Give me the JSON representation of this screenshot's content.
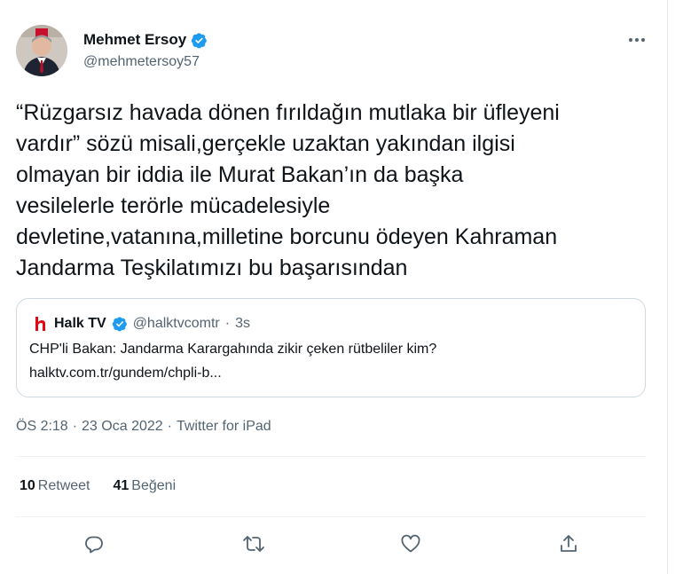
{
  "author": {
    "name": "Mehmet Ersoy",
    "handle": "@mehmetersoy57"
  },
  "tweet": {
    "text": "“Rüzgarsız havada dönen fırıldağın mutlaka bir üfleyeni\nvardır” sözü misali,gerçekle uzaktan yakından ilgisi\nolmayan bir iddia ile Murat Bakan’ın da başka\nvesilelerle terörle mücadelesiyle\ndevletine,vatanına,milletine borcunu ödeyen Kahraman\nJandarma Teşkilatımızı bu başarısından"
  },
  "quote": {
    "name": "Halk TV",
    "handle": "@halktvcomtr",
    "separator": "·",
    "time": "3s",
    "text": "CHP'li Bakan: Jandarma Karargahında zikir çeken rütbeliler kim?",
    "link": "halktv.com.tr/gundem/chpli-b..."
  },
  "meta": {
    "time": "ÖS 2:18",
    "sep1": "·",
    "date": "23 Oca 2022",
    "sep2": "·",
    "source": "Twitter for iPad"
  },
  "stats": {
    "retweets_count": "10",
    "retweets_label": "Retweet",
    "likes_count": "41",
    "likes_label": "Beğeni"
  },
  "icons": {
    "verified": "verified-badge-icon",
    "more": "more-icon",
    "reply": "reply-icon",
    "retweet": "retweet-icon",
    "like": "heart-icon",
    "share": "share-icon"
  },
  "colors": {
    "verified_blue": "#1d9bf0",
    "secondary_text": "#536471",
    "halk_red": "#e30613"
  }
}
